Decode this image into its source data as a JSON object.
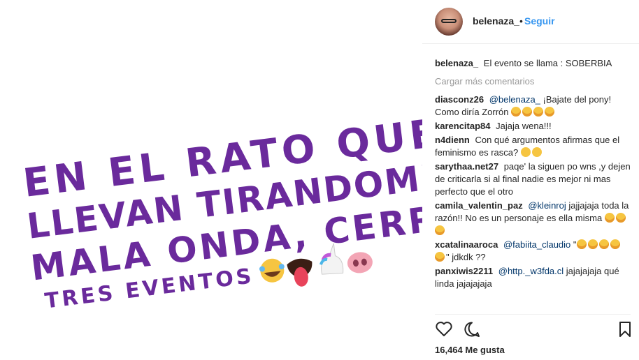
{
  "post": {
    "image_text_lines": [
      "EN EL RATO QUE",
      "LLEVAN TIRANDOME",
      "MALA ONDA, CERRE",
      "TRES EVENTOS ."
    ],
    "text_color": "#6a2a9c"
  },
  "header": {
    "username": "belenaza_",
    "separator": "•",
    "follow_label": "Seguir"
  },
  "caption": {
    "user": "belenaza_",
    "text": "El evento se llama : SOBERBIA"
  },
  "load_more": "Cargar más comentarios",
  "comments": [
    {
      "user": "diasconz26",
      "mention": "@belenaza_",
      "text": "¡Bajate del pony! Como diría Zorrón"
    },
    {
      "user": "karencitap84",
      "mention": "",
      "text": "Jajaja wena!!!"
    },
    {
      "user": "n4dienn",
      "mention": "",
      "text": "Con qué argumentos afirmas que el feminismo es rasca?"
    },
    {
      "user": "sarythaa.net27",
      "mention": "",
      "text": "paqe' la siguen po wns ,y dejen de criticarla si al final nadie es mejor ni mas perfecto que el otro"
    },
    {
      "user": "camila_valentin_paz",
      "mention": "@kleinroj",
      "text": "jajjajaja toda la razón!! No es un personaje es ella misma"
    },
    {
      "user": "xcatalinaaroca",
      "mention": "@fabiita_claudio",
      "text": "\"",
      "text_after": "\" jdkdk ??"
    },
    {
      "user": "panxiwis2211",
      "mention": "@http._w3fda.cl",
      "text": "jajajajaja qué linda jajajajaja"
    }
  ],
  "likes": "16,464 Me gusta",
  "icons": [
    "heart-icon",
    "comment-icon",
    "bookmark-icon"
  ],
  "colors": {
    "link": "#3897f0",
    "mention": "#003569",
    "muted": "#999999"
  }
}
